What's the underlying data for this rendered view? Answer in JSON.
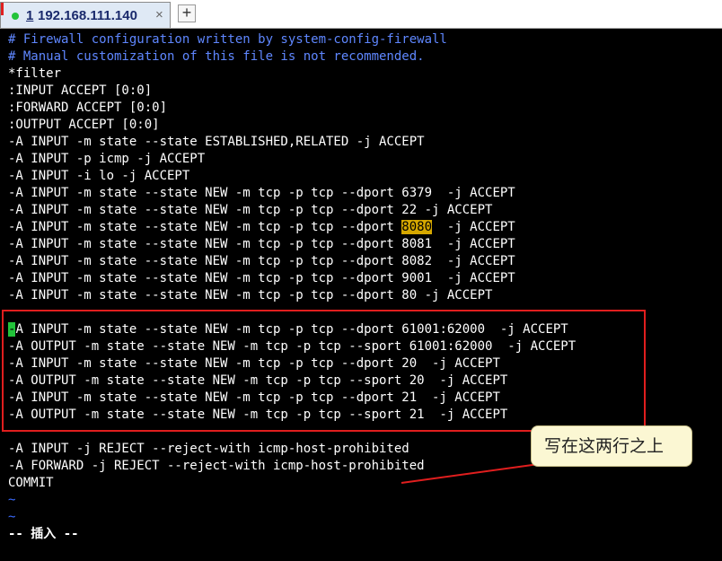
{
  "tab": {
    "number": "1",
    "title": "192.168.111.140",
    "close_glyph": "×",
    "add_glyph": "+"
  },
  "editor": {
    "lines": [
      "# Firewall configuration written by system-config-firewall",
      "# Manual customization of this file is not recommended.",
      "*filter",
      ":INPUT ACCEPT [0:0]",
      ":FORWARD ACCEPT [0:0]",
      ":OUTPUT ACCEPT [0:0]",
      "-A INPUT -m state --state ESTABLISHED,RELATED -j ACCEPT",
      "-A INPUT -p icmp -j ACCEPT",
      "-A INPUT -i lo -j ACCEPT",
      "-A INPUT -m state --state NEW -m tcp -p tcp --dport 6379  -j ACCEPT",
      "-A INPUT -m state --state NEW -m tcp -p tcp --dport 22 -j ACCEPT",
      "-A INPUT -m state --state NEW -m tcp -p tcp --dport 8080  -j ACCEPT",
      "-A INPUT -m state --state NEW -m tcp -p tcp --dport 8081  -j ACCEPT",
      "-A INPUT -m state --state NEW -m tcp -p tcp --dport 8082  -j ACCEPT",
      "-A INPUT -m state --state NEW -m tcp -p tcp --dport 9001  -j ACCEPT",
      "-A INPUT -m state --state NEW -m tcp -p tcp --dport 80 -j ACCEPT",
      "",
      "-A INPUT -m state --state NEW -m tcp -p tcp --dport 61001:62000  -j ACCEPT",
      "-A OUTPUT -m state --state NEW -m tcp -p tcp --sport 61001:62000  -j ACCEPT",
      "-A INPUT -m state --state NEW -m tcp -p tcp --dport 20  -j ACCEPT",
      "-A OUTPUT -m state --state NEW -m tcp -p tcp --sport 20  -j ACCEPT",
      "-A INPUT -m state --state NEW -m tcp -p tcp --dport 21  -j ACCEPT",
      "-A OUTPUT -m state --state NEW -m tcp -p tcp --sport 21  -j ACCEPT",
      "",
      "-A INPUT -j REJECT --reject-with icmp-host-prohibited",
      "-A FORWARD -j REJECT --reject-with icmp-host-prohibited",
      "COMMIT",
      "~",
      "~",
      "-- 插入 --"
    ],
    "highlight": {
      "line": 11,
      "text": "8080"
    },
    "cursor_line": 17
  },
  "annotation": {
    "callout_text": "写在这两行之上"
  },
  "colors": {
    "background": "#000000",
    "text": "#ffffff",
    "comment": "#5f87ff",
    "highlight": "#d6a800",
    "cursor": "#22c33a",
    "annotation_red": "#e01e1e",
    "callout_bg": "#fbf7d3"
  }
}
